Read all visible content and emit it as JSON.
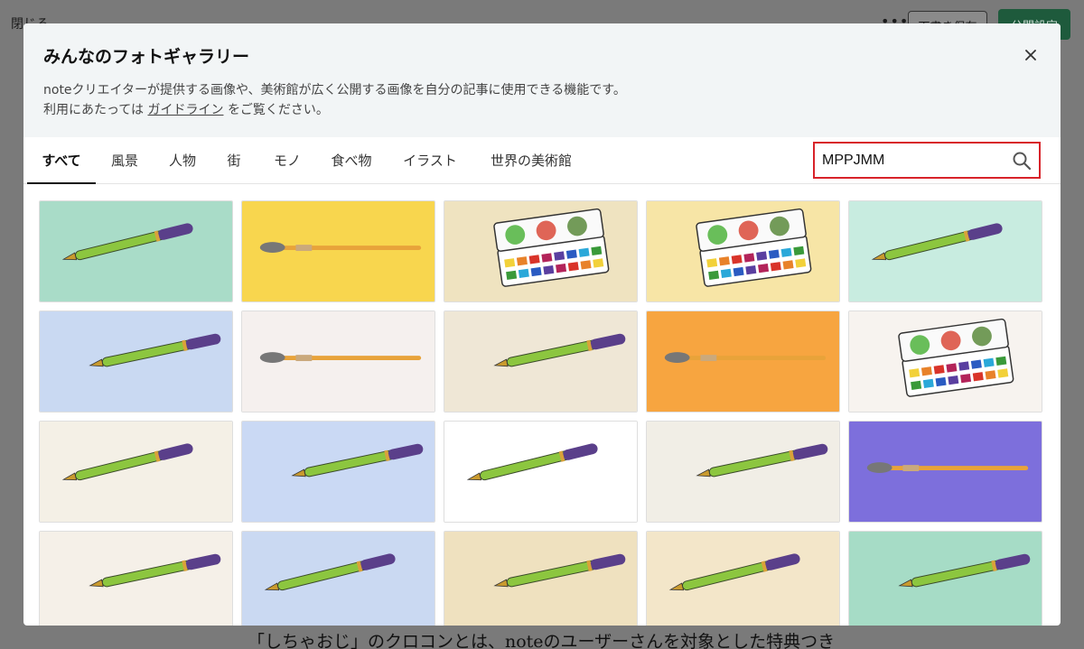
{
  "background": {
    "close_label": "閉じる",
    "more_icon": "ellipsis-icon",
    "draft_label": "下書き保存",
    "publish_label": "公開設定",
    "footer_text": "「しちゃおじ」のクロコンとは、noteのユーザーさんを対象とした特典つき"
  },
  "modal": {
    "title": "みんなのフォトギャラリー",
    "desc_line1": "noteクリエイターが提供する画像や、美術館が広く公開する画像を自分の記事に使用できる機能です。",
    "desc_pre": "利用にあたっては",
    "desc_link": "ガイドライン",
    "desc_post": "をご覧ください。",
    "close_icon": "close-icon"
  },
  "tabs": [
    {
      "label": "すべて",
      "active": true
    },
    {
      "label": "風景"
    },
    {
      "label": "人物"
    },
    {
      "label": "街"
    },
    {
      "label": "モノ"
    },
    {
      "label": "食べ物"
    },
    {
      "label": "イラスト"
    },
    {
      "label": "世界の美術館"
    }
  ],
  "search": {
    "value": "MPPJMM",
    "highlight_color": "#d8232a"
  },
  "grid": {
    "images": [
      {
        "subject": "fountain-pen",
        "bg": "#a9dcc8"
      },
      {
        "subject": "paintbrush",
        "bg": "#f8d64e"
      },
      {
        "subject": "watercolor-palette",
        "bg": "#efe3c0"
      },
      {
        "subject": "watercolor-palette",
        "bg": "#f7e5a6"
      },
      {
        "subject": "fountain-pen",
        "bg": "#c8ece0"
      },
      {
        "subject": "fountain-pen",
        "bg": "#c9d9f2"
      },
      {
        "subject": "paintbrush",
        "bg": "#f5f0ee"
      },
      {
        "subject": "fountain-pen",
        "bg": "#efe7d6"
      },
      {
        "subject": "paintbrush",
        "bg": "#f7a540"
      },
      {
        "subject": "watercolor-palette",
        "bg": "#f7f3ef"
      },
      {
        "subject": "fountain-pen",
        "bg": "#f4f0e6"
      },
      {
        "subject": "fountain-pen",
        "bg": "#cad9f4"
      },
      {
        "subject": "fountain-pen",
        "bg": "#ffffff"
      },
      {
        "subject": "fountain-pen",
        "bg": "#f1eee6"
      },
      {
        "subject": "paintbrush",
        "bg": "#7d6fdc"
      },
      {
        "subject": "fountain-pen",
        "bg": "#f5f0e8"
      },
      {
        "subject": "fountain-pen",
        "bg": "#cad9f2"
      },
      {
        "subject": "fountain-pen",
        "bg": "#efe1bf"
      },
      {
        "subject": "fountain-pen",
        "bg": "#f3e6c9"
      },
      {
        "subject": "fountain-pen",
        "bg": "#a6dcc6"
      }
    ]
  }
}
